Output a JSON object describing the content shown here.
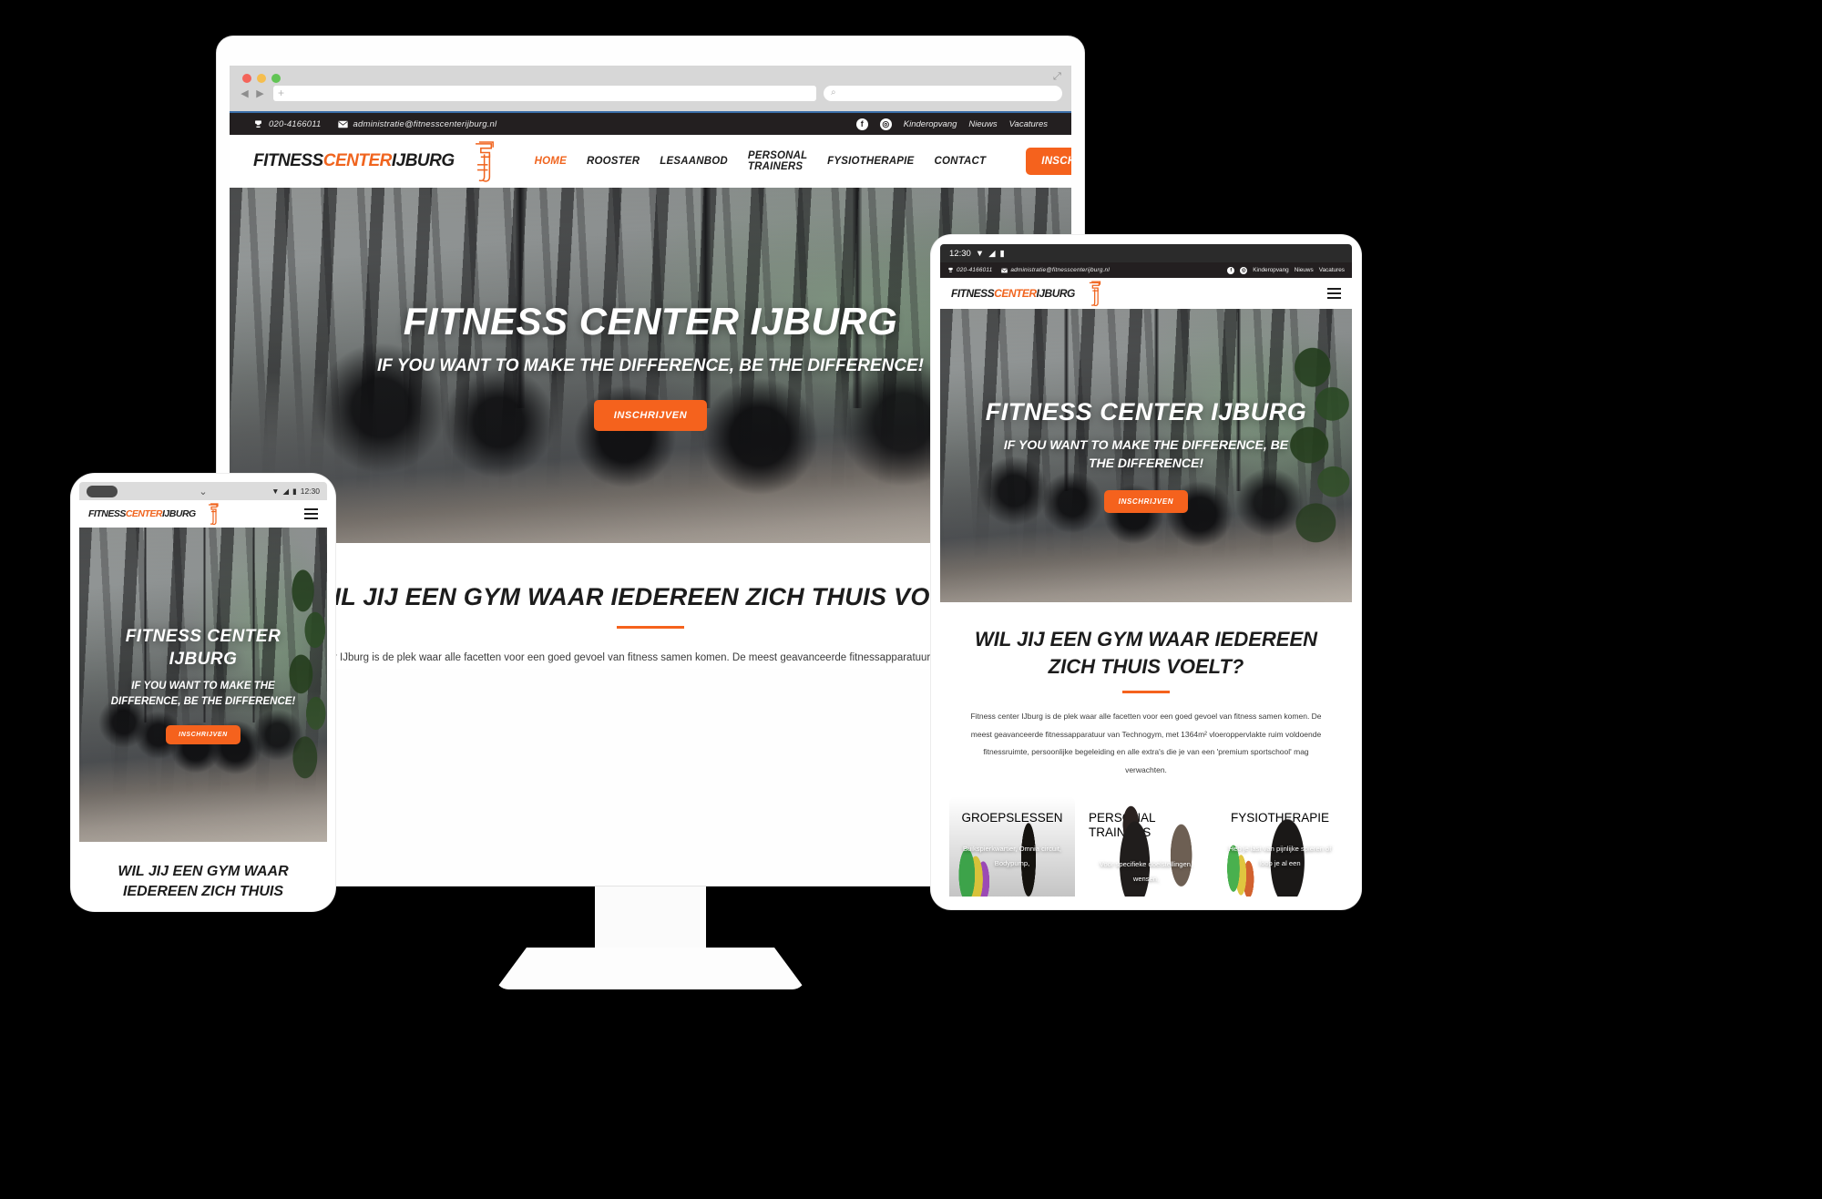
{
  "brand": {
    "logo_part1": "FITNESS",
    "logo_part2": "CENTER",
    "logo_part3": "IJBURG",
    "accent_color": "#f5621d",
    "dark_color": "#231f20"
  },
  "browser": {
    "url_value": "",
    "url_placeholder": "",
    "search_placeholder": "",
    "new_tab_icon": "plus-icon",
    "back_icon": "chevron-left-icon",
    "forward_icon": "chevron-right-icon",
    "search_icon": "search-icon",
    "resize_icon": "resize-icon"
  },
  "topbar": {
    "phone_icon": "phone-icon",
    "phone": "020-4166011",
    "mail_icon": "mail-icon",
    "email": "administratie@fitnesscenterijburg.nl",
    "facebook_icon": "facebook-icon",
    "instagram_icon": "instagram-icon",
    "links": [
      "Kinderopvang",
      "Nieuws",
      "Vacatures"
    ]
  },
  "nav": {
    "items": [
      {
        "label": "HOME",
        "active": true
      },
      {
        "label": "ROOSTER",
        "active": false
      },
      {
        "label": "LESAANBOD",
        "active": false
      },
      {
        "label": "PERSONAL TRAINERS",
        "active": false
      },
      {
        "label": "FYSIOTHERAPIE",
        "active": false
      },
      {
        "label": "CONTACT",
        "active": false
      }
    ],
    "cta_label": "INSCHRIJVEN",
    "menu_icon": "hamburger-menu-icon"
  },
  "hero": {
    "title": "FITNESS CENTER IJBURG",
    "subtitle": "IF YOU WANT TO MAKE THE DIFFERENCE, BE THE DIFFERENCE!",
    "button_label": "INSCHRIJVEN"
  },
  "intro": {
    "heading": "WIL JIJ EEN GYM WAAR IEDEREEN ZICH THUIS VOELT?",
    "paragraph": "Fitness center IJburg is de plek waar alle facetten voor een goed gevoel van fitness samen komen. De meest geavanceerde fitnessapparatuur van Technogym, met 1364m² vloeroppervlakte ruim voldoende fitnessruimte, persoonlijke begeleiding en alle extra's die je van een 'premium sportschool' mag verwachten."
  },
  "cards": [
    {
      "title": "GROEPSLESSEN",
      "desc": "Buikspierkwartier, Omnia circuit,  Bodypump,"
    },
    {
      "title": "PERSONAL TRAINERS",
      "desc": "Voor specifieke doelstellingen, wensen,"
    },
    {
      "title": "FYSIOTHERAPIE",
      "desc": "Heb je last  van pijnlijke spieren of loop je al een"
    }
  ],
  "devices": {
    "tablet": {
      "status_time": "12:30",
      "wifi_icon": "wifi-icon",
      "signal_icon": "signal-icon",
      "battery_icon": "battery-icon"
    },
    "phone": {
      "status_time": "12:30",
      "wifi_icon": "wifi-icon",
      "signal_icon": "signal-icon",
      "battery_icon": "battery-icon",
      "chevron_icon": "chevron-down-icon"
    }
  }
}
